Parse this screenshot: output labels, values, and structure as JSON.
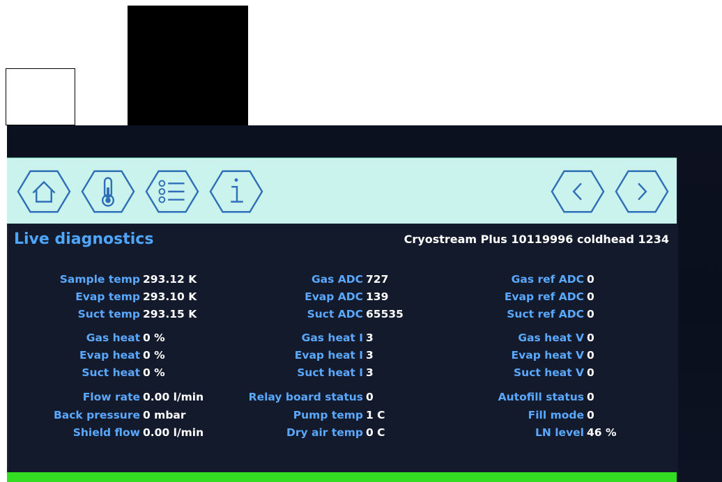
{
  "screen": {
    "title": "Live diagnostics",
    "device": "Cryostream Plus 10119996 coldhead 1234"
  },
  "toolbar": {
    "buttons": [
      {
        "icon": "home-icon"
      },
      {
        "icon": "thermometer-icon"
      },
      {
        "icon": "list-icon"
      },
      {
        "icon": "info-icon"
      },
      {
        "icon": "chevron-left-icon"
      },
      {
        "icon": "chevron-right-icon"
      }
    ]
  },
  "diagnostics": {
    "col1": [
      {
        "label": "Sample temp",
        "value": "293.12 K"
      },
      {
        "label": "Evap temp",
        "value": "293.10 K"
      },
      {
        "label": "Suct temp",
        "value": "293.15 K"
      },
      {
        "label": "Gas heat",
        "value": "0 %"
      },
      {
        "label": "Evap heat",
        "value": "0 %"
      },
      {
        "label": "Suct heat",
        "value": "0 %"
      },
      {
        "label": "Flow rate",
        "value": "0.00 l/min"
      },
      {
        "label": "Back pressure",
        "value": "0 mbar"
      },
      {
        "label": "Shield flow",
        "value": "0.00 l/min"
      }
    ],
    "col2": [
      {
        "label": "Gas ADC",
        "value": "727"
      },
      {
        "label": "Evap ADC",
        "value": "139"
      },
      {
        "label": "Suct ADC",
        "value": "65535"
      },
      {
        "label": "Gas heat I",
        "value": "3"
      },
      {
        "label": "Evap heat I",
        "value": "3"
      },
      {
        "label": "Suct heat I",
        "value": "3"
      },
      {
        "label": "Relay board status",
        "value": "0"
      },
      {
        "label": "Pump temp",
        "value": "1 C"
      },
      {
        "label": "Dry air temp",
        "value": "0 C"
      }
    ],
    "col3": [
      {
        "label": "Gas ref ADC",
        "value": "0"
      },
      {
        "label": "Evap ref ADC",
        "value": "0"
      },
      {
        "label": "Suct ref ADC",
        "value": "0"
      },
      {
        "label": "Gas heat V",
        "value": "0"
      },
      {
        "label": "Evap heat V",
        "value": "0"
      },
      {
        "label": "Suct heat V",
        "value": "0"
      },
      {
        "label": "Autofill status",
        "value": "0"
      },
      {
        "label": "Fill mode",
        "value": "0"
      },
      {
        "label": "LN level",
        "value": "46 %"
      }
    ]
  },
  "colors": {
    "label": "#5aa8ff",
    "value": "#ffffff",
    "title": "#4ea6ff",
    "toolbar": "#c9f3ec",
    "icon": "#2f6fb8",
    "status_bar": "#33dd22"
  }
}
